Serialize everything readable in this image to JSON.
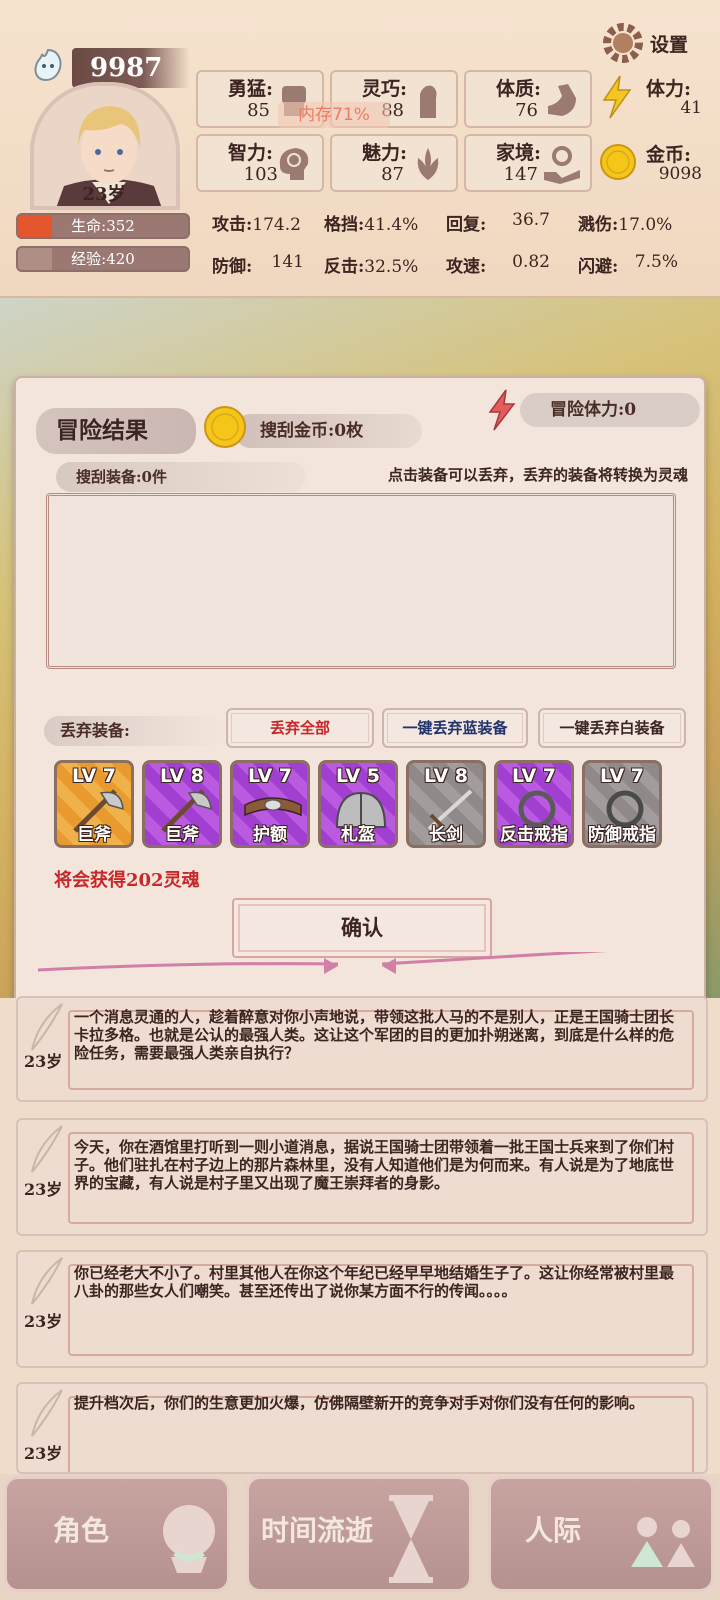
{
  "player": {
    "souls": "9987",
    "age": "23岁",
    "life": "生命:352",
    "life_fraction": 0.2,
    "exp": "经验:420",
    "exp_fraction": 0.2,
    "memory": "内存71%"
  },
  "settings_label": "设置",
  "attributes": [
    {
      "label": "勇猛:",
      "value": "85",
      "icon": "fist-icon"
    },
    {
      "label": "灵巧:",
      "value": "88",
      "icon": "hand-icon"
    },
    {
      "label": "体质:",
      "value": "76",
      "icon": "muscle-arm-icon"
    },
    {
      "label": "智力:",
      "value": "103",
      "icon": "brain-icon"
    },
    {
      "label": "魅力:",
      "value": "87",
      "icon": "lotus-icon"
    },
    {
      "label": "家境:",
      "value": "147",
      "icon": "money-hand-icon"
    }
  ],
  "stamina": {
    "label": "体力:",
    "value": "41"
  },
  "gold": {
    "label": "金币:",
    "value": "9098"
  },
  "combat": {
    "row1": [
      {
        "label": "攻击:",
        "value": "174.2"
      },
      {
        "label": "格挡:",
        "value": "41.4%"
      },
      {
        "label": "回复:",
        "value": "36.7"
      },
      {
        "label": "溅伤:",
        "value": "17.0%"
      }
    ],
    "row2": [
      {
        "label": "防御:",
        "value": "141"
      },
      {
        "label": "反击:",
        "value": "32.5%"
      },
      {
        "label": "攻速:",
        "value": "0.82"
      },
      {
        "label": "闪避:",
        "value": "7.5%"
      }
    ]
  },
  "panel": {
    "title": "冒险结果",
    "loot_gold": "搜刮金币:0枚",
    "adventure_stamina": "冒险体力:0",
    "loot_equip": "搜刮装备:0件",
    "tip": "点击装备可以丢弃，丢弃的装备将转换为灵魂",
    "discard_label": "丢弃装备:",
    "btn_discard_all": "丢弃全部",
    "btn_discard_blue": "一键丢弃蓝装备",
    "btn_discard_white": "一键丢弃白装备",
    "soul_gain": "将会获得202灵魂",
    "confirm": "确认"
  },
  "equipment": [
    {
      "level": "LV 7",
      "name": "巨斧",
      "quality": "orange",
      "icon": "axe-icon"
    },
    {
      "level": "LV 8",
      "name": "巨斧",
      "quality": "purple",
      "icon": "axe-icon"
    },
    {
      "level": "LV 7",
      "name": "护额",
      "quality": "purple",
      "icon": "headband-icon"
    },
    {
      "level": "LV 5",
      "name": "札盔",
      "quality": "purple",
      "icon": "helmet-icon"
    },
    {
      "level": "LV 8",
      "name": "长剑",
      "quality": "gray",
      "icon": "sword-icon"
    },
    {
      "level": "LV 7",
      "name": "反击戒指",
      "quality": "purple",
      "icon": "ring-icon"
    },
    {
      "level": "LV 7",
      "name": "防御戒指",
      "quality": "gray",
      "icon": "ring-icon"
    }
  ],
  "stories": [
    {
      "age": "23岁",
      "text": "一个消息灵通的人，趁着醉意对你小声地说，带领这批人马的不是别人，正是王国骑士团长卡拉多格。也就是公认的最强人类。这让这个军团的目的更加扑朔迷离，到底是什么样的危险任务，需要最强人类亲自执行？"
    },
    {
      "age": "23岁",
      "text": "今天，你在酒馆里打听到一则小道消息，据说王国骑士团带领着一批王国士兵来到了你们村子。他们驻扎在村子边上的那片森林里，没有人知道他们是为何而来。有人说是为了地底世界的宝藏，有人说是村子里又出现了魔王崇拜者的身影。"
    },
    {
      "age": "23岁",
      "text": "你已经老大不小了。村里其他人在你这个年纪已经早早地结婚生子了。这让你经常被村里最八卦的那些女人们嘲笑。甚至还传出了说你某方面不行的传闻。。。。"
    },
    {
      "age": "23岁",
      "text": "提升档次后，你们的生意更加火爆，仿佛隔壁新开的竞争对手对你们没有任何的影响。"
    }
  ],
  "nav": [
    {
      "label": "角色",
      "icon": "character-icon"
    },
    {
      "label": "时间流逝",
      "icon": "hourglass-icon"
    },
    {
      "label": "人际",
      "icon": "people-icon"
    }
  ]
}
